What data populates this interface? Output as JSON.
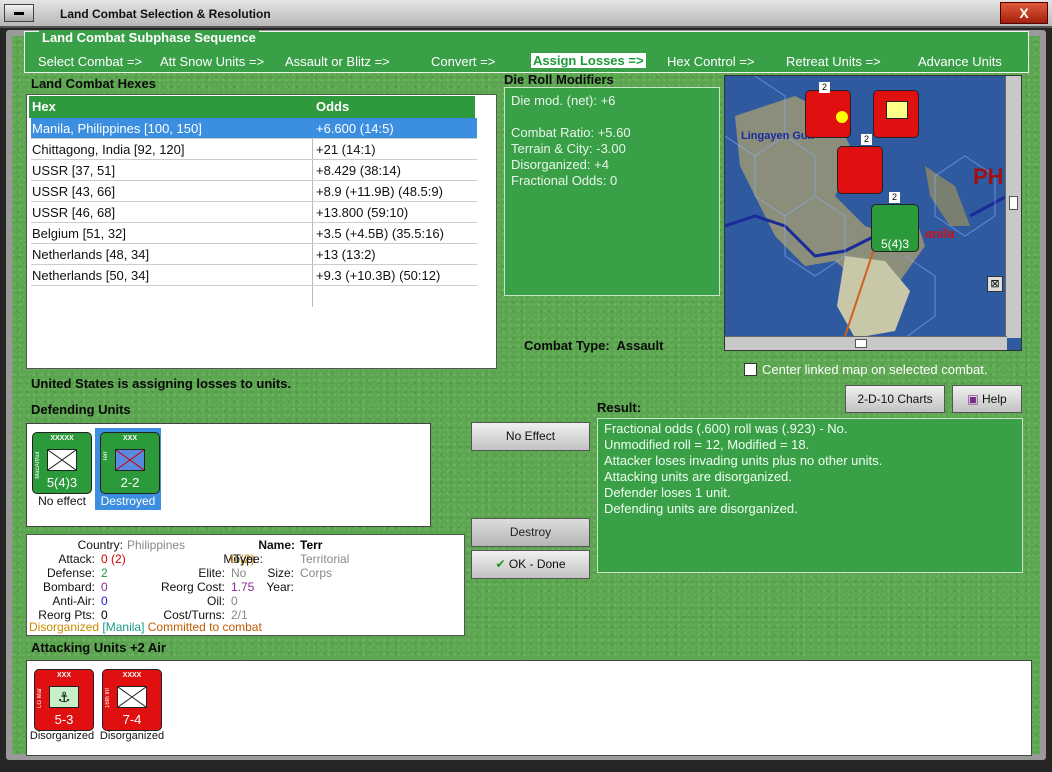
{
  "window": {
    "title": "Land Combat Selection & Resolution",
    "close": "X"
  },
  "phase": {
    "legend": "Land Combat Subphase Sequence",
    "steps": [
      "Select Combat =>",
      "Att Snow Units =>",
      "Assault or Blitz =>",
      "Convert =>",
      "Assign Losses =>",
      "Hex Control =>",
      "Retreat Units =>",
      "Advance Units"
    ],
    "active_index": 4
  },
  "hexes": {
    "title": "Land Combat Hexes",
    "col_hex": "Hex",
    "col_odds": "Odds",
    "rows": [
      {
        "hex": "Manila, Philippines [100, 150]",
        "odds": "+6.600 (14:5)"
      },
      {
        "hex": "Chittagong, India [92, 120]",
        "odds": "+21 (14:1)"
      },
      {
        "hex": "USSR [37, 51]",
        "odds": "+8.429 (38:14)"
      },
      {
        "hex": "USSR [43, 66]",
        "odds": "+8.9 (+11.9B) (48.5:9)"
      },
      {
        "hex": "USSR [46, 68]",
        "odds": "+13.800 (59:10)"
      },
      {
        "hex": "Belgium [51, 32]",
        "odds": "+3.5 (+4.5B) (35.5:16)"
      },
      {
        "hex": "Netherlands [48, 34]",
        "odds": "+13 (13:2)"
      },
      {
        "hex": "Netherlands [50, 34]",
        "odds": "+9.3 (+10.3B) (50:12)"
      }
    ]
  },
  "drm": {
    "title": "Die Roll Modifiers",
    "lines": [
      "Die mod. (net): +6",
      "",
      "Combat Ratio: +5.60",
      "Terrain & City: -3.00",
      "Disorganized: +4",
      "Fractional Odds: 0"
    ]
  },
  "combat_type": {
    "label": "Combat Type:",
    "value": "Assault"
  },
  "map": {
    "label_gulf": "Lingayen Gulf",
    "label_ph": "PH",
    "label_manila": "anila",
    "center_linked": "Center linked map on selected combat.",
    "stack_counts": [
      "2",
      "2",
      "2"
    ]
  },
  "status": "United States is assigning losses to units.",
  "defending": {
    "title": "Defending Units",
    "units": [
      {
        "echelon": "XXXXX",
        "side": "MacArthur",
        "strength": "5(4)3",
        "caption": "No effect"
      },
      {
        "echelon": "XXX",
        "side": "Terr",
        "side2": "PHI",
        "strength": "2-2",
        "caption": "Destroyed"
      }
    ]
  },
  "buttons": {
    "no_effect": "No Effect",
    "destroy": "Destroy",
    "ok_done": "OK - Done",
    "charts": "2-D-10 Charts",
    "help": "Help"
  },
  "result": {
    "title": "Result:",
    "lines": [
      "Fractional odds (.600) roll was (.923)  - No.",
      "Unmodified roll = 12, Modified = 18.",
      "Attacker loses invading units plus no other units.",
      "Attacking units are disorganized.",
      "Defender loses 1 unit.",
      "Defending units are disorganized."
    ]
  },
  "info": {
    "country_k": "Country:",
    "country_v": "Philippines",
    "attack_k": "Attack:",
    "attack_v": "0",
    "attack_v2": "(2)",
    "defense_k": "Defense:",
    "defense_v": "2",
    "bombard_k": "Bombard:",
    "bombard_v": "0",
    "antiair_k": "Anti-Air:",
    "antiair_v": "0",
    "reorgpts_k": "Reorg Pts:",
    "reorgpts_v": "0",
    "name_k": "Name:",
    "name_v": "Terr",
    "move_k": "Move:",
    "move_v": "0",
    "move_v2": "(2)",
    "elite_k": "Elite:",
    "elite_v": "No",
    "reorgcost_k": "Reorg Cost:",
    "reorgcost_v": "1.75",
    "oil_k": "Oil:",
    "oil_v": "0",
    "costturns_k": "Cost/Turns:",
    "costturns_v": "2/1",
    "type_k": "Type:",
    "type_v": "Territorial",
    "size_k": "Size:",
    "size_v": "Corps",
    "year_k": "Year:",
    "year_v": "",
    "status_disorg": "Disorganized",
    "status_city": "[Manila]",
    "status_committed": "Committed to combat"
  },
  "attacking": {
    "title": "Attacking Units +2 Air",
    "units": [
      {
        "echelon": "XXX",
        "side": "LG Mar",
        "strength": "5-3",
        "caption": "Disorganized"
      },
      {
        "echelon": "XXXX",
        "side": "16th Inf",
        "strength": "7-4",
        "caption": "Disorganized"
      }
    ]
  }
}
